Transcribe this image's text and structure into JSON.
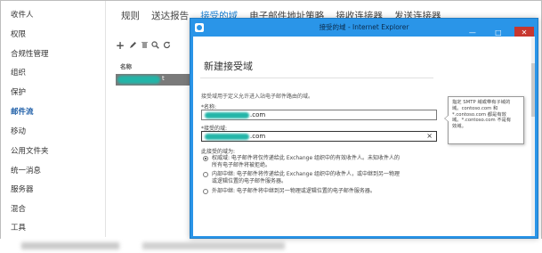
{
  "left_nav": {
    "items": [
      {
        "label": "收件人",
        "active": false
      },
      {
        "label": "权限",
        "active": false
      },
      {
        "label": "合规性管理",
        "active": false
      },
      {
        "label": "组织",
        "active": false
      },
      {
        "label": "保护",
        "active": false
      },
      {
        "label": "邮件流",
        "active": true
      },
      {
        "label": "移动",
        "active": false
      },
      {
        "label": "公用文件夹",
        "active": false
      },
      {
        "label": "统一消息",
        "active": false
      },
      {
        "label": "服务器",
        "active": false
      },
      {
        "label": "混合",
        "active": false
      },
      {
        "label": "工具",
        "active": false
      }
    ]
  },
  "tabs": [
    {
      "label": "规则",
      "active": false
    },
    {
      "label": "送达报告",
      "active": false
    },
    {
      "label": "接受的域",
      "active": true
    },
    {
      "label": "电子邮件地址策略",
      "active": false
    },
    {
      "label": "接收连接器",
      "active": false
    },
    {
      "label": "发送连接器",
      "active": false
    }
  ],
  "toolbar": {
    "add": "+",
    "icons": [
      "add-icon",
      "edit-icon",
      "delete-icon",
      "search-icon",
      "refresh-icon"
    ]
  },
  "list": {
    "column_header": "名称",
    "row_suffix": "t"
  },
  "dialog": {
    "window_title": "接受的域 - Internet Explorer",
    "heading": "新建接受域",
    "description": "接受域用于定义允许进入站电子邮件路由的域。",
    "name_label": "*名称:",
    "name_value": ".com",
    "domain_label": "*接受的域:",
    "domain_value": ".com",
    "clear_glyph": "×",
    "domain_type_label": "此接受的域为:",
    "options": [
      {
        "text": "权威域: 电子邮件将仅传递给此 Exchange 组织中的有效收件人。未知收件人的",
        "text2": "所有电子邮件将被拒绝。",
        "selected": true
      },
      {
        "text": "内部中继: 电子邮件将传递给此 Exchange 组织中的收件人，或中继到另一物理",
        "text2": "或逻辑位置的电子邮件服务器。",
        "selected": false
      },
      {
        "text": "外部中继: 电子邮件将中继到另一物理或逻辑位置的电子邮件服务器。",
        "text2": "",
        "selected": false
      }
    ],
    "tooltip": [
      "指定 SMTP 域或带有子域的",
      "域。contoso.com 和",
      "*.contoso.com 都是有效",
      "域。*.contoso.com 不是有",
      "效域。"
    ],
    "window_buttons": {
      "minimize": "—",
      "maximize": "□",
      "close": "✕"
    }
  },
  "colors": {
    "accent": "#1b7fd0",
    "window_chrome": "#2a95e8",
    "close_button": "#c7372f",
    "selected_row": "#7a7a7a"
  }
}
